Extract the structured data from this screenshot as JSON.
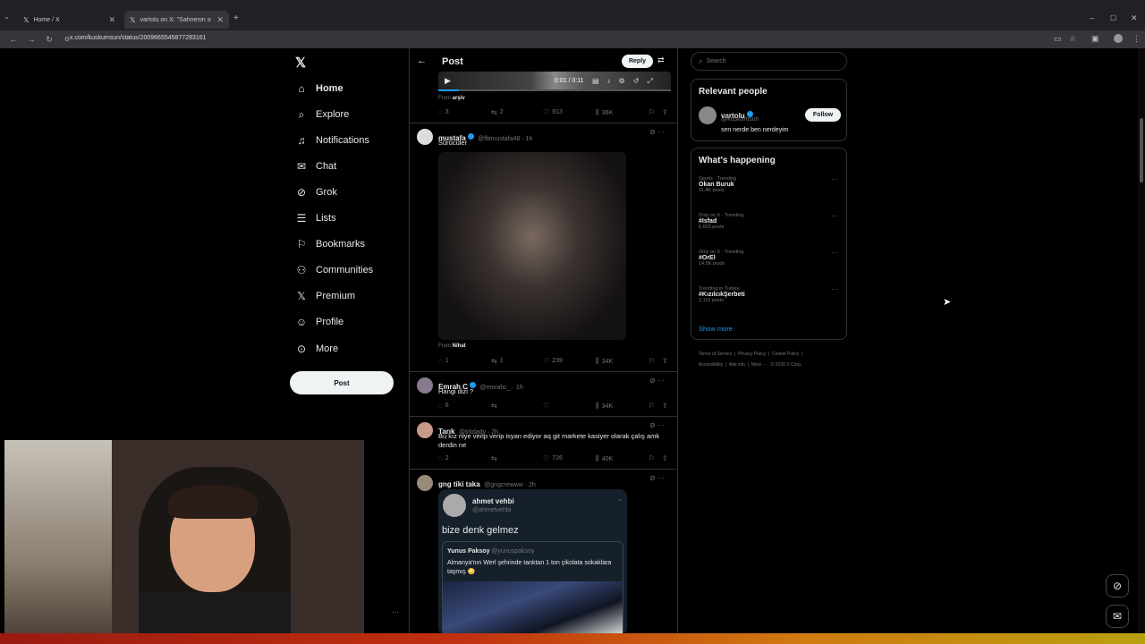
{
  "browser": {
    "tabs": [
      {
        "title": "Home / X"
      },
      {
        "title": "vartolu on X: \"Sahnenin so..."
      }
    ],
    "url": "x.com/kuskumsun/status/2009665545877283161"
  },
  "sidebar": {
    "items": [
      {
        "label": "Home",
        "icon": "home-icon"
      },
      {
        "label": "Explore",
        "icon": "search-icon"
      },
      {
        "label": "Notifications",
        "icon": "bell-icon"
      },
      {
        "label": "Chat",
        "icon": "mail-icon"
      },
      {
        "label": "Grok",
        "icon": "grok-icon"
      },
      {
        "label": "Lists",
        "icon": "list-icon"
      },
      {
        "label": "Bookmarks",
        "icon": "bookmark-icon"
      },
      {
        "label": "Communities",
        "icon": "people-icon"
      },
      {
        "label": "Premium",
        "icon": "x-icon"
      },
      {
        "label": "Profile",
        "icon": "user-icon"
      },
      {
        "label": "More",
        "icon": "more-icon"
      }
    ],
    "post_button": "Post"
  },
  "main": {
    "header": "Post",
    "reply_button": "Reply",
    "video": {
      "time": "0:01 / 0:11",
      "from_label": "From",
      "from_name": "arşiv",
      "progress": 0.09
    },
    "first_stats": {
      "replies": "3",
      "reposts": "2",
      "likes": "913",
      "views": "36K"
    },
    "replies": [
      {
        "name": "mustafa",
        "handle": "@fblmustafa48 · 1h",
        "text": "Sürücüler",
        "from_label": "From",
        "from_name": "Nihat",
        "replies": "1",
        "reposts": "1",
        "likes": "239",
        "views": "34K"
      },
      {
        "name": "Emrah C",
        "handle": "@emrahc_ · 1h",
        "text": "Hangi dizi ?",
        "replies": "6",
        "reposts": "",
        "likes": "",
        "views": "34K"
      },
      {
        "name": "Tarık",
        "handle": "@trkdady · 2h",
        "text": "Bu kız niye verip verip isyan ediyor aq git markete kasiyer olarak çalış amk derdin ne",
        "replies": "2",
        "reposts": "",
        "likes": "726",
        "views": "40K"
      },
      {
        "name": "gng tiki taka",
        "handle": "@gngcrewww · 2h",
        "text": ""
      }
    ],
    "quote": {
      "name": "ahmet vehbi",
      "handle": "@ahmetvehbi",
      "text": "bize denk gelmez",
      "inner_name": "Yunus Paksoy",
      "inner_handle": "@yunuspaksoy",
      "inner_text": "Almanya'nın Werl şehrinde tanktan 1 ton çikolata sokaklara taşmış 😳"
    }
  },
  "right": {
    "search_placeholder": "Search",
    "relevant_title": "Relevant people",
    "person": {
      "name": "vartolu",
      "handle": "@kuskumsun",
      "bio": "sen nerde ben nerdeyim",
      "follow": "Follow"
    },
    "happening_title": "What's happening",
    "trends": [
      {
        "cat": "Sports · Trending",
        "name": "Okan Buruk",
        "count": "11.4K posts"
      },
      {
        "cat": "Only on X · Trending",
        "name": "#Isfad",
        "count": "6,603 posts"
      },
      {
        "cat": "Only on X · Trending",
        "name": "#OrEl",
        "count": "14.5K posts"
      },
      {
        "cat": "Trending in Turkey",
        "name": "#KızılcıkŞerbeti",
        "count": "2,115 posts"
      }
    ],
    "show_more": "Show more",
    "footer": [
      "Terms of Service",
      "Privacy Policy",
      "Cookie Policy",
      "Accessibility",
      "Ads info",
      "More ···",
      "© 2026 X Corp."
    ]
  },
  "colors": {
    "accent": "#1d9bf0",
    "bg": "#000000",
    "border": "#2f3336"
  }
}
